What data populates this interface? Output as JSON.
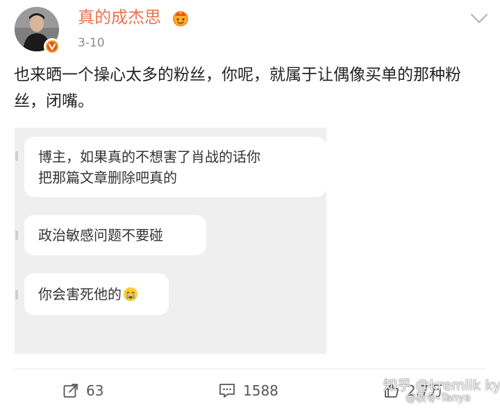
{
  "post": {
    "username": "真的成杰思",
    "date": "3-10",
    "text": "也来晒一个操心太多的粉丝，你呢，就属于让偶像买单的那种粉丝，闭嘴。",
    "username_color": "#eb7350"
  },
  "image": {
    "messages": [
      {
        "lines": [
          "博主，如果真的不想害了肖战的话你",
          "把那篇文章删除吧真的"
        ]
      },
      {
        "lines": [
          "政治敏感问题不要碰"
        ]
      },
      {
        "lines": [
          "你会害死他的"
        ],
        "emoji": "crying-face-icon"
      }
    ]
  },
  "actions": {
    "repost_count": "63",
    "comment_count": "1588",
    "like_count": "2.7万"
  },
  "watermarks": {
    "zhihu": "知乎 @kremlik kye",
    "weibo": "@秋冬-Tanya"
  }
}
